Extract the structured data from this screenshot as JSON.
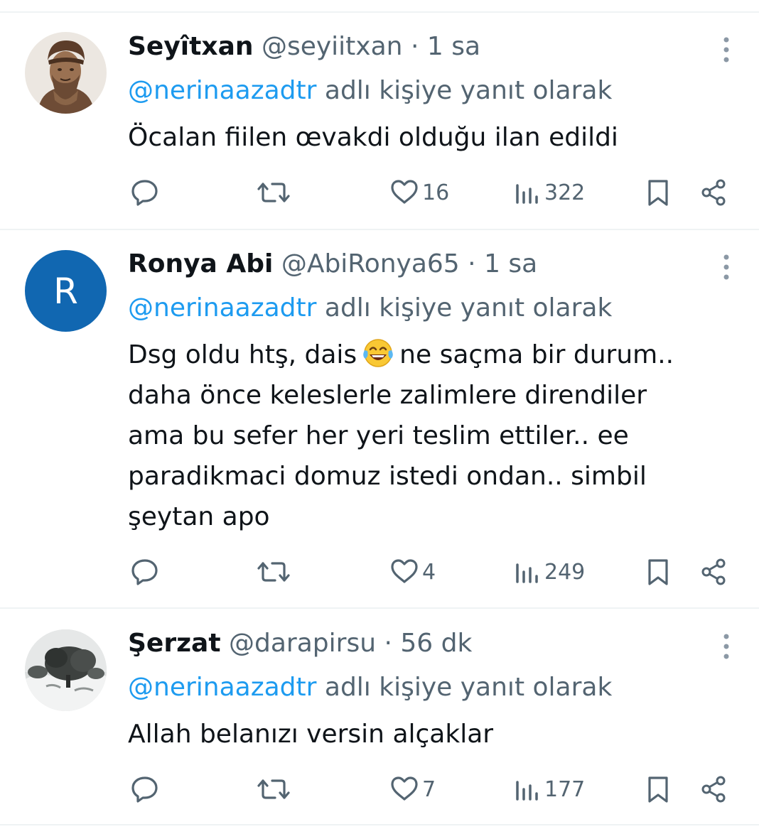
{
  "tweets": [
    {
      "name": "Seyîtxan",
      "handle": "@seyiitxan",
      "sep": "·",
      "time": "1 sa",
      "reply_to": "@nerinaazadtr",
      "reply_suffix": "adlı kişiye yanıt olarak",
      "lines": [
        "Öcalan fiilen œvakdi olduğu ilan edildi"
      ],
      "likes": "16",
      "views": "322",
      "avatar_icon": "bust-statue-photo"
    },
    {
      "name": "Ronya Abi",
      "handle": "@AbiRonya65",
      "sep": "·",
      "time": "1 sa",
      "reply_to": "@nerinaazadtr",
      "reply_suffix": "adlı kişiye yanıt olarak",
      "avatar_letter": "R",
      "line1_before": "Dsg oldu htş, dais",
      "line1_after": "ne saçma bir durum..",
      "lines": [
        "daha önce keleslerle zalimlere direndiler",
        "ama bu sefer her yeri teslim ettiler.. ee",
        "paradikmaci domuz istedi ondan.. simbil",
        "şeytan apo"
      ],
      "likes": "4",
      "views": "249",
      "emoji_icon": "laughing-tears-emoji"
    },
    {
      "name": "Şerzat",
      "handle": "@darapirsu",
      "sep": "·",
      "time": "56 dk",
      "reply_to": "@nerinaazadtr",
      "reply_suffix": "adlı kişiye yanıt olarak",
      "lines": [
        "Allah belanızı versin alçaklar"
      ],
      "likes": "7",
      "views": "177",
      "avatar_icon": "snowy-tree-photo"
    }
  ],
  "colors": {
    "text": "#0f1419",
    "secondary": "#536471",
    "link": "#1d9bf0",
    "divider": "#eff3f4",
    "avatar_blue": "#1167b1"
  }
}
